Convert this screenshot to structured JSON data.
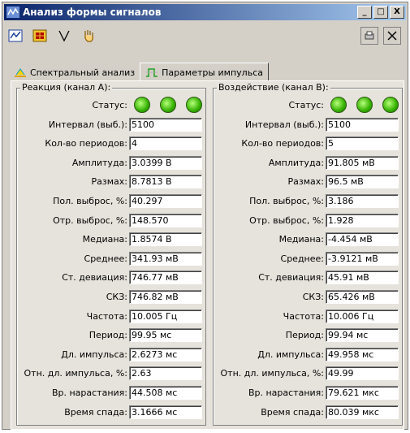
{
  "window": {
    "title": "Анализ формы сигналов",
    "caption_buttons": [
      "_",
      "□",
      "X"
    ]
  },
  "toolbar": {
    "icons": [
      "chart-icon",
      "grid-icon",
      "cursor-icon",
      "hand-icon"
    ],
    "right_icons": [
      "print-icon",
      "close-icon"
    ]
  },
  "tabs": [
    {
      "label": "Спектральный анализ",
      "active": false
    },
    {
      "label": "Параметры импульса",
      "active": true
    }
  ],
  "left_group": {
    "title": "Реакция (канал А):",
    "status_label": "Статус:",
    "rows": [
      {
        "label": "Интервал (выб.):",
        "value": "5100"
      },
      {
        "label": "Кол-во периодов:",
        "value": "4"
      },
      {
        "label": "Амплитуда:",
        "value": "3.0399 В"
      },
      {
        "label": "Размах:",
        "value": "8.7813 В"
      },
      {
        "label": "Пол. выброс, %:",
        "value": "40.297"
      },
      {
        "label": "Отр. выброс, %:",
        "value": "148.570"
      },
      {
        "label": "Медиана:",
        "value": "1.8574 В"
      },
      {
        "label": "Среднее:",
        "value": "341.93 мВ"
      },
      {
        "label": "Ст. девиация:",
        "value": "746.77 мВ"
      },
      {
        "label": "СКЗ:",
        "value": "746.82 мВ"
      },
      {
        "label": "Частота:",
        "value": "10.005 Гц"
      },
      {
        "label": "Период:",
        "value": "99.95 мс"
      },
      {
        "label": "Дл. импульса:",
        "value": "2.6273 мс"
      },
      {
        "label": "Отн. дл. импульса, %:",
        "value": "2.63"
      },
      {
        "label": "Вр. нарастания:",
        "value": "44.508 мс"
      },
      {
        "label": "Время спада:",
        "value": "3.1666 мс"
      }
    ]
  },
  "right_group": {
    "title": "Воздействие (канал В):",
    "status_label": "Статус:",
    "rows": [
      {
        "label": "Интервал (выб.):",
        "value": "5100"
      },
      {
        "label": "Кол-во периодов:",
        "value": "5"
      },
      {
        "label": "Амплитуда:",
        "value": "91.805 мВ"
      },
      {
        "label": "Размах:",
        "value": "96.5 мВ"
      },
      {
        "label": "Пол. выброс, %:",
        "value": "3.186"
      },
      {
        "label": "Отр. выброс, %:",
        "value": "1.928"
      },
      {
        "label": "Медиана:",
        "value": "-4.454 мВ"
      },
      {
        "label": "Среднее:",
        "value": "-3.9121 мВ"
      },
      {
        "label": "Ст. девиация:",
        "value": "45.91 мВ"
      },
      {
        "label": "СКЗ:",
        "value": "65.426 мВ"
      },
      {
        "label": "Частота:",
        "value": "10.006 Гц"
      },
      {
        "label": "Период:",
        "value": "99.94 мс"
      },
      {
        "label": "Дл. импульса:",
        "value": "49.958 мс"
      },
      {
        "label": "Отн. дл. импульса, %:",
        "value": "49.99"
      },
      {
        "label": "Вр. нарастания:",
        "value": "79.621 мкс"
      },
      {
        "label": "Время спада:",
        "value": "80.039 мкс"
      }
    ]
  }
}
